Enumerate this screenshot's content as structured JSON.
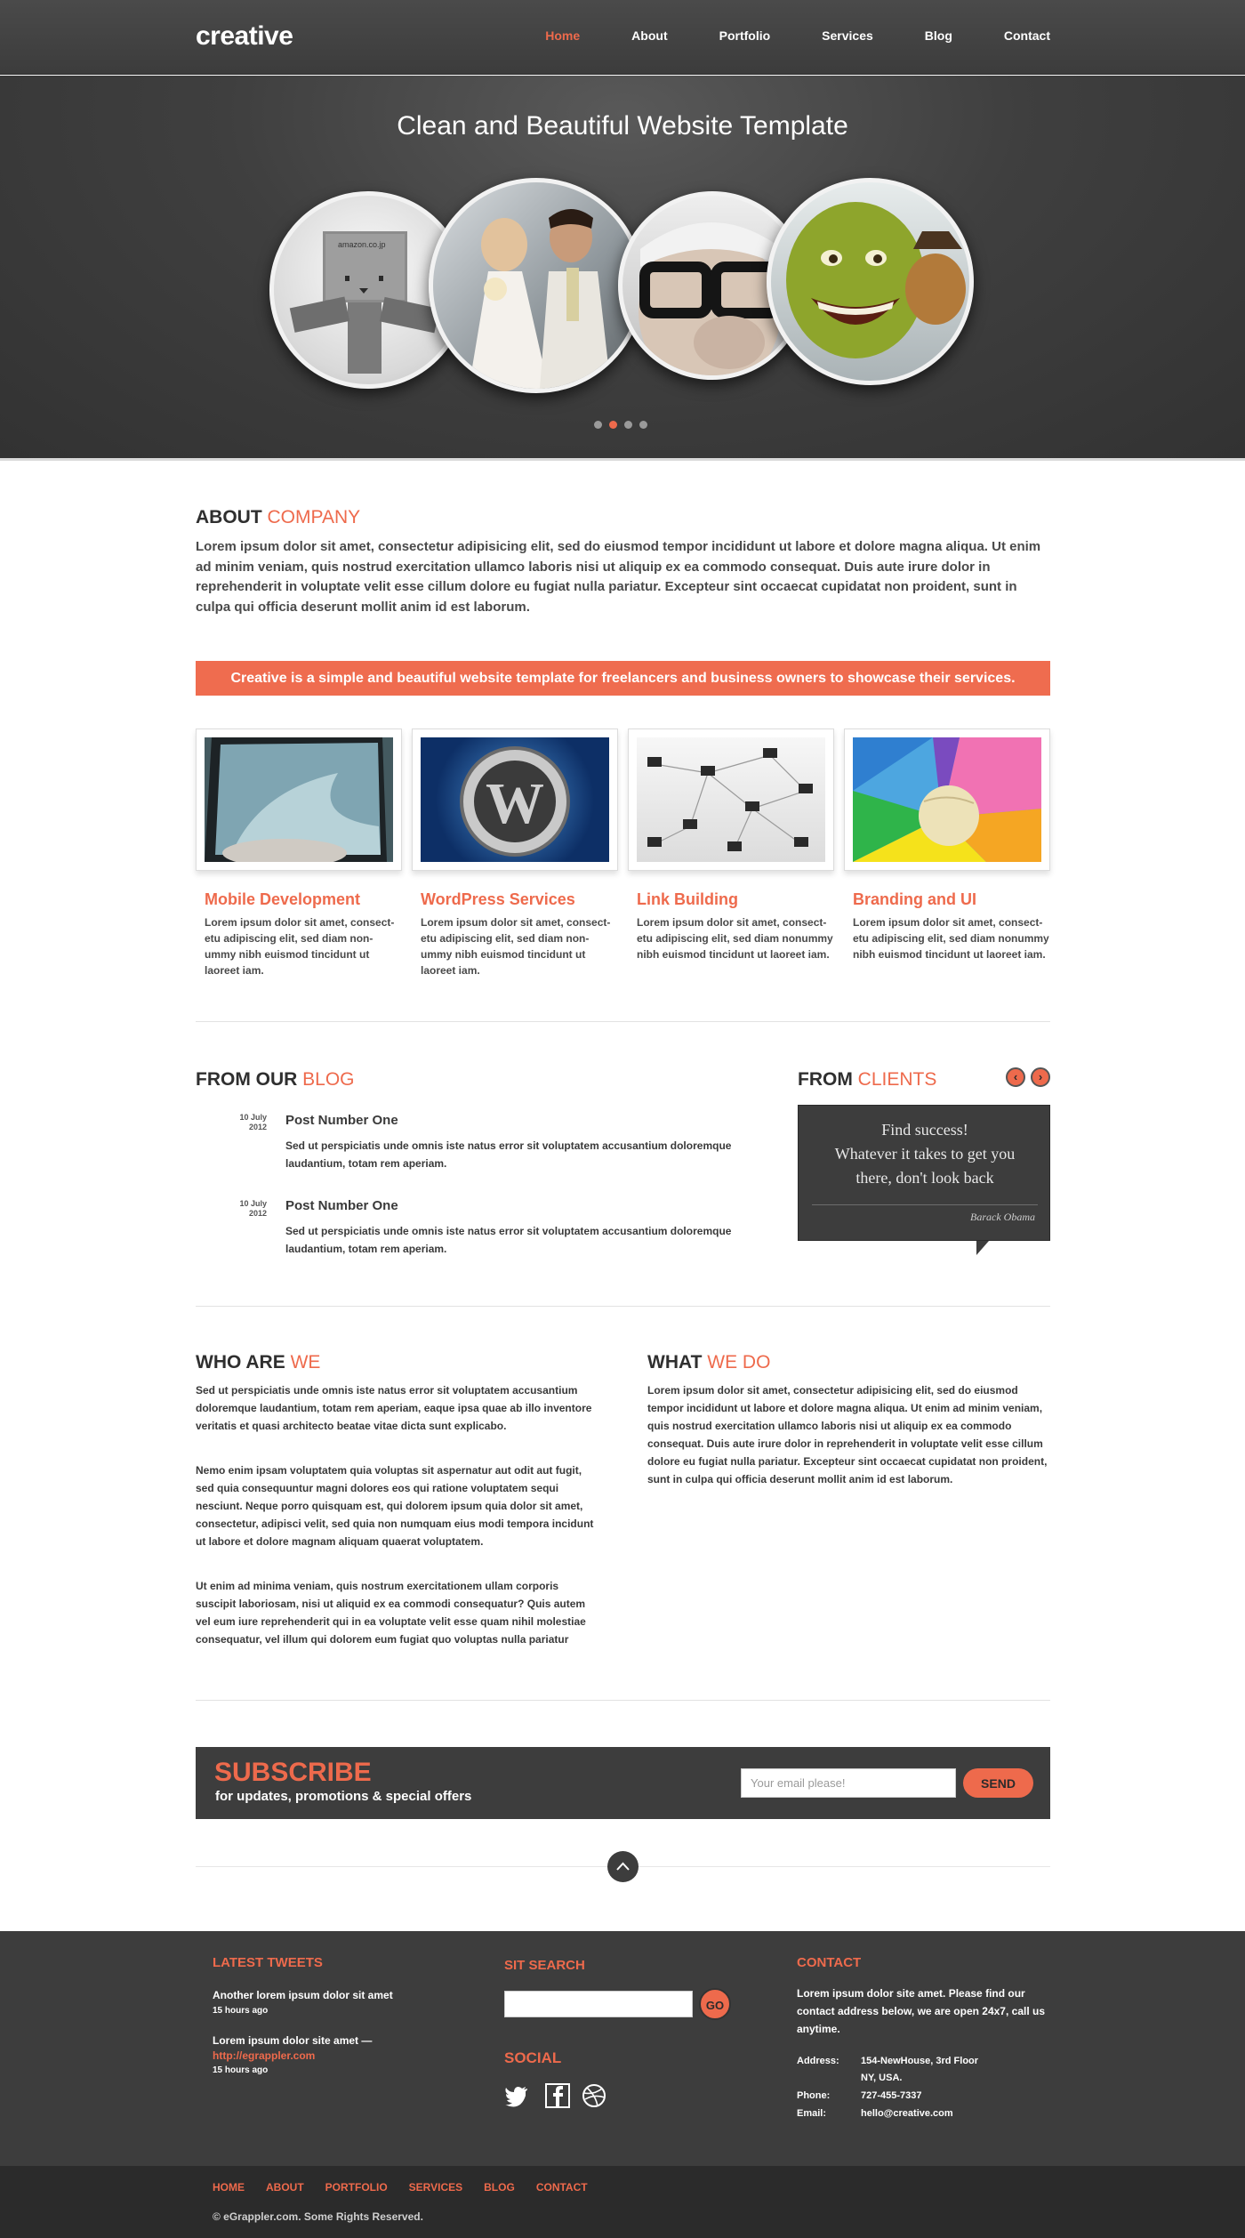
{
  "header": {
    "logo": "creative",
    "nav": [
      "Home",
      "About",
      "Portfolio",
      "Services",
      "Blog",
      "Contact"
    ],
    "active": "Home"
  },
  "hero": {
    "title": "Clean and Beautiful Website Template",
    "slider_dots": 4,
    "active_dot": 2
  },
  "about": {
    "title_a": "ABOUT ",
    "title_b": "COMPANY",
    "text": "Lorem ipsum dolor sit amet, consectetur adipisicing elit, sed do eiusmod tempor incididunt ut labore et dolore magna aliqua. Ut enim ad minim veniam, quis nostrud exercitation ullamco laboris nisi ut aliquip ex ea commodo consequat. Duis aute irure dolor in reprehenderit in voluptate velit esse cillum dolore eu fugiat nulla pariatur. Excepteur sint occaecat cupidatat non proident, sunt in culpa qui officia deserunt mollit anim id est laborum."
  },
  "banner": "Creative is a simple and beautiful website template for freelancers  and business owners to showcase their services.",
  "services": [
    {
      "title": "Mobile Development",
      "text": "Lorem ipsum dolor sit amet, consect-etu adipiscing elit, sed diam non-ummy nibh euismod tincidunt ut laoreet iam."
    },
    {
      "title": "WordPress Services",
      "text": "Lorem ipsum dolor sit amet, consect-etu adipiscing elit, sed diam non-ummy nibh euismod tincidunt ut laoreet iam."
    },
    {
      "title": "Link Building",
      "text": "Lorem ipsum dolor sit amet, consect-etu adipiscing elit, sed diam nonummy nibh euismod tincidunt ut laoreet iam."
    },
    {
      "title": "Branding and UI",
      "text": "Lorem ipsum dolor sit amet, consect-etu adipiscing elit, sed diam nonummy nibh euismod tincidunt ut laoreet iam."
    }
  ],
  "blog": {
    "title_a": "FROM OUR ",
    "title_b": "BLOG",
    "posts": [
      {
        "day": "10 July",
        "year": "2012",
        "title": "Post Number One",
        "text": "Sed ut perspiciatis unde omnis iste natus error sit voluptatem accusantium doloremque laudantium, totam rem aperiam."
      },
      {
        "day": "10 July",
        "year": "2012",
        "title": "Post Number One",
        "text": "Sed ut perspiciatis unde omnis iste natus error sit voluptatem accusantium doloremque laudantium, totam rem aperiam."
      }
    ]
  },
  "clients": {
    "title_a": "FROM ",
    "title_b": "CLIENTS",
    "quote_1": "Find success!",
    "quote_2": "Whatever it takes to get you",
    "quote_3": "there, don't look back",
    "author": "Barack Obama"
  },
  "who": {
    "title_a": "WHO ARE ",
    "title_b": "WE",
    "p1": "Sed ut perspiciatis unde omnis iste natus error sit voluptatem accusantium doloremque laudantium, totam rem aperiam, eaque ipsa quae ab illo inventore veritatis et quasi architecto beatae vitae dicta sunt explicabo.",
    "p2": "Nemo enim ipsam voluptatem quia voluptas sit aspernatur aut odit aut fugit, sed quia consequuntur magni dolores eos qui ratione voluptatem sequi nesciunt. Neque porro quisquam est, qui dolorem ipsum quia dolor sit amet, consectetur, adipisci velit, sed quia non numquam eius modi tempora incidunt ut labore et dolore magnam aliquam quaerat voluptatem.",
    "p3": "Ut enim ad minima veniam, quis nostrum exercitationem ullam corporis suscipit laboriosam, nisi ut aliquid ex ea commodi consequatur? Quis autem vel eum iure reprehenderit qui in ea voluptate velit esse quam nihil molestiae consequatur, vel illum qui dolorem eum fugiat quo voluptas nulla pariatur"
  },
  "what": {
    "title_a": "WHAT ",
    "title_b": "WE DO",
    "p1": "Lorem ipsum dolor sit amet, consectetur adipisicing elit, sed do eiusmod tempor incididunt ut labore et dolore magna aliqua. Ut enim ad minim veniam, quis nostrud exercitation ullamco laboris nisi ut aliquip ex ea commodo consequat. Duis aute irure dolor in reprehenderit in voluptate velit esse cillum dolore eu fugiat nulla pariatur. Excepteur sint occaecat cupidatat non proident, sunt in culpa qui officia deserunt mollit anim id est laborum."
  },
  "subscribe": {
    "title": "SUBSCRIBE",
    "text": "for updates, promotions & special offers",
    "placeholder": "Your email please!",
    "button": "SEND"
  },
  "footer": {
    "tweets_title": "LATEST TWEETS",
    "tweet1": "Another lorem ipsum dolor sit amet",
    "tweet1_time": "15 hours ago",
    "tweet2": "Lorem ipsum dolor site amet —",
    "tweet2_link": "http://egrappler.com",
    "tweet2_time": "15 hours ago",
    "search_title": "SIT SEARCH",
    "go": "GO",
    "social_title": "SOCIAL",
    "social_icons": [
      "twitter-icon",
      "facebook-icon",
      "dribbble-icon"
    ],
    "contact_title": "CONTACT",
    "contact_text": "Lorem ipsum dolor site amet. Please find our contact address below, we are open 24x7, call us anytime.",
    "address_label": "Address:",
    "address_1": "154-NewHouse, 3rd Floor",
    "address_2": "NY, USA.",
    "phone_label": "Phone:",
    "phone": "727-455-7337",
    "email_label": "Email:",
    "email": "hello@creative.com"
  },
  "bottom": {
    "nav": [
      "HOME",
      "ABOUT",
      "PORTFOLIO",
      "SERVICES",
      "BLOG",
      "CONTACT"
    ],
    "copyright": "© eGrappler.com. Some Rights Reserved."
  },
  "colors": {
    "accent": "#ee6a4c",
    "dark": "#3d3d3d",
    "darker": "#2b2b2b"
  }
}
